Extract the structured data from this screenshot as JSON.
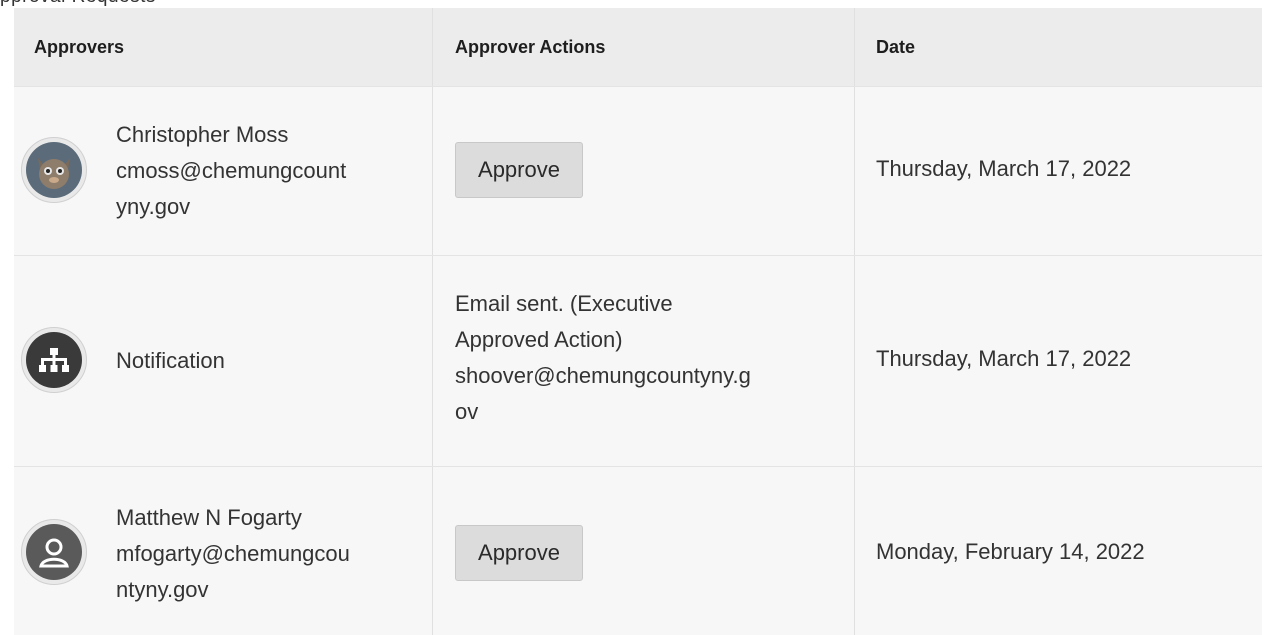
{
  "page_fragment": "pproval Requests",
  "table": {
    "headers": [
      "Approvers",
      "Approver Actions",
      "Date"
    ],
    "rows": [
      {
        "avatar": "cat-avatar-icon",
        "name": "Christopher Moss",
        "email_lines": [
          "cmoss@chemungcount",
          "yny.gov"
        ],
        "action_button": "Approve",
        "date": "Thursday, March 17, 2022"
      },
      {
        "avatar": "org-chart-icon",
        "name": "Notification",
        "action_lines": [
          "Email sent. (Executive",
          "Approved Action)",
          "shoover@chemungcountyny.g",
          "ov"
        ],
        "date": "Thursday, March 17, 2022"
      },
      {
        "avatar": "person-icon",
        "name": "Matthew N Fogarty",
        "email_lines": [
          "mfogarty@chemungcou",
          "ntyny.gov"
        ],
        "action_button": "Approve",
        "date": "Monday, February 14, 2022"
      }
    ]
  },
  "colors": {
    "header_bg": "#ececec",
    "row_bg": "#f7f7f7",
    "button_bg": "#dcdcdc",
    "icon_dark": "#3a3a3a"
  }
}
